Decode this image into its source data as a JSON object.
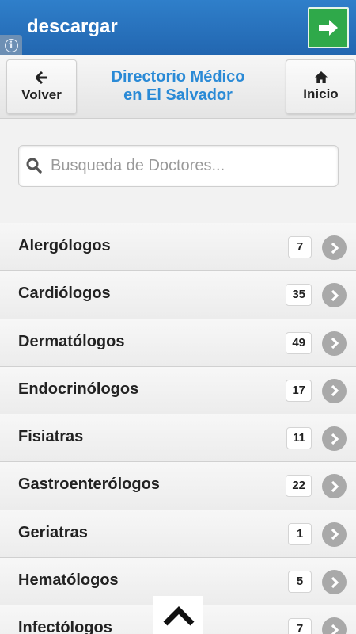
{
  "ad": {
    "title": "descargar",
    "info_icon": "info-icon",
    "go_icon": "arrow-right-icon",
    "colors": {
      "banner": "#2673bf",
      "go_button": "#2fa94a"
    }
  },
  "header": {
    "back_label": "Volver",
    "back_icon": "arrow-left-icon",
    "title_line1": "Directorio Médico",
    "title_line2": "en El Salvador",
    "home_label": "Inicio",
    "home_icon": "home-icon",
    "title_color": "#2a8ad6"
  },
  "search": {
    "placeholder": "Busqueda de Doctores...",
    "value": "",
    "icon": "search-icon"
  },
  "specialties": [
    {
      "name": "Alergólogos",
      "count": "7"
    },
    {
      "name": "Cardiólogos",
      "count": "35"
    },
    {
      "name": "Dermatólogos",
      "count": "49"
    },
    {
      "name": "Endocrinólogos",
      "count": "17"
    },
    {
      "name": "Fisiatras",
      "count": "11"
    },
    {
      "name": "Gastroenterólogos",
      "count": "22"
    },
    {
      "name": "Geriatras",
      "count": "1"
    },
    {
      "name": "Hematólogos",
      "count": "5"
    },
    {
      "name": "Infectólogos",
      "count": "7"
    }
  ],
  "scroll_top_icon": "chevron-up-icon"
}
